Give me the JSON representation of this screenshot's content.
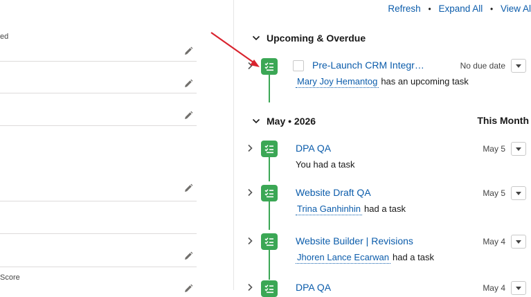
{
  "left_panel": {
    "fields": [
      {
        "label": "ed"
      },
      {
        "label": ""
      },
      {
        "label": ""
      },
      {
        "label": ""
      },
      {
        "label": ""
      },
      {
        "label": ""
      },
      {
        "label": ""
      },
      {
        "label": "Score"
      }
    ]
  },
  "toolbar": {
    "refresh": "Refresh",
    "expand_all": "Expand All",
    "view_all": "View Al",
    "separator": "•"
  },
  "upcoming": {
    "title": "Upcoming & Overdue",
    "items": [
      {
        "title": "Pre-Launch CRM Integra...",
        "person": "Mary Joy Hemantog",
        "summary": "has an upcoming task",
        "date": "No due date"
      }
    ]
  },
  "month": {
    "title": "May • 2026",
    "right_label": "This Month",
    "items": [
      {
        "title": "DPA QA",
        "person": "",
        "summary": "You had a task",
        "date": "May 5"
      },
      {
        "title": "Website Draft QA",
        "person": "Trina Ganhinhin",
        "summary": "had a task",
        "date": "May 5"
      },
      {
        "title": "Website Builder | Revisions",
        "person": "Jhoren Lance Ecarwan",
        "summary": "had a task",
        "date": "May 4"
      },
      {
        "title": "DPA QA",
        "person": "",
        "summary": "",
        "date": "May 4"
      }
    ]
  },
  "colors": {
    "task_green": "#3ba755",
    "link_blue": "#0b5cab",
    "annotation_arrow": "#d9232e"
  }
}
